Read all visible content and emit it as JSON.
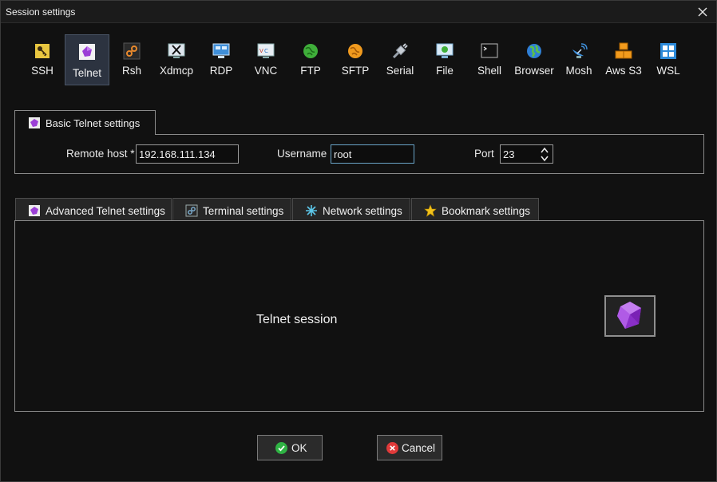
{
  "window": {
    "title": "Session settings"
  },
  "toolbar": {
    "items": [
      {
        "label": "SSH",
        "icon": "key-icon"
      },
      {
        "label": "Telnet",
        "icon": "telnet-gem-icon",
        "active": true
      },
      {
        "label": "Rsh",
        "icon": "rsh-icon"
      },
      {
        "label": "Xdmcp",
        "icon": "x-display-icon"
      },
      {
        "label": "RDP",
        "icon": "monitor-icon"
      },
      {
        "label": "VNC",
        "icon": "vnc-icon"
      },
      {
        "label": "FTP",
        "icon": "green-globe-icon"
      },
      {
        "label": "SFTP",
        "icon": "orange-globe-icon"
      },
      {
        "label": "Serial",
        "icon": "serial-plug-icon"
      },
      {
        "label": "File",
        "icon": "file-monitor-icon"
      },
      {
        "label": "Shell",
        "icon": "terminal-icon"
      },
      {
        "label": "Browser",
        "icon": "earth-icon"
      },
      {
        "label": "Mosh",
        "icon": "satellite-dish-icon"
      },
      {
        "label": "Aws S3",
        "icon": "aws-boxes-icon"
      },
      {
        "label": "WSL",
        "icon": "windows-icon"
      }
    ]
  },
  "basic": {
    "tab_label": "Basic Telnet settings",
    "remote_host_label": "Remote host *",
    "remote_host_value": "192.168.111.134",
    "username_label": "Username",
    "username_value": "root",
    "port_label": "Port",
    "port_value": "23"
  },
  "tabs": [
    {
      "label": "Advanced Telnet settings",
      "icon": "telnet-gem-icon"
    },
    {
      "label": "Terminal settings",
      "icon": "terminal-settings-icon"
    },
    {
      "label": "Network settings",
      "icon": "network-star-icon"
    },
    {
      "label": "Bookmark settings",
      "icon": "star-icon"
    }
  ],
  "panel": {
    "session_label": "Telnet session"
  },
  "buttons": {
    "ok_label": "OK",
    "cancel_label": "Cancel"
  },
  "colors": {
    "accent_purple": "#9b3fd6",
    "active_tool_bg": "#2c3340",
    "ok_green": "#2fb344",
    "cancel_red": "#e03a3a",
    "focus_border": "#6aa4c8"
  }
}
